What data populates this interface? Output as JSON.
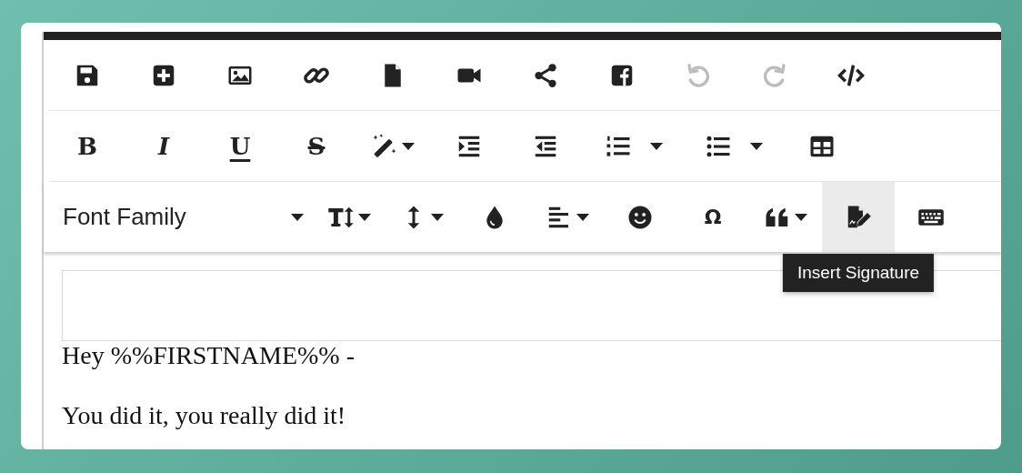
{
  "toolbar": {
    "rows": [
      [
        {
          "disabled": false
        },
        {
          "disabled": false
        },
        {
          "disabled": false
        },
        {
          "disabled": false
        },
        {
          "disabled": false
        },
        {
          "disabled": false
        },
        {
          "disabled": false
        },
        {
          "disabled": false
        },
        {
          "disabled": true
        },
        {
          "disabled": true
        },
        {
          "disabled": false
        }
      ],
      [
        {
          "label": "B",
          "dropdown": false
        },
        {
          "label": "I",
          "dropdown": false
        },
        {
          "label": "U",
          "dropdown": false
        },
        {
          "label": "S",
          "dropdown": false
        },
        {
          "dropdown": true
        },
        {
          "dropdown": false
        },
        {
          "dropdown": false
        },
        {
          "dropdown": true
        },
        {
          "dropdown": true
        },
        {
          "dropdown": false
        }
      ],
      [
        {
          "kind": "select",
          "value": "Font Family",
          "dropdown": true,
          "hovered": false
        },
        {
          "kind": "button",
          "dropdown": true,
          "hovered": false
        },
        {
          "kind": "button",
          "dropdown": true,
          "hovered": false
        },
        {
          "kind": "button",
          "dropdown": false,
          "hovered": false
        },
        {
          "kind": "button",
          "dropdown": true,
          "hovered": false
        },
        {
          "kind": "button",
          "dropdown": false,
          "hovered": false
        },
        {
          "kind": "button",
          "label": "Ω",
          "dropdown": false,
          "hovered": false
        },
        {
          "kind": "button",
          "dropdown": true,
          "hovered": false
        },
        {
          "kind": "button",
          "dropdown": false,
          "hovered": true
        },
        {
          "kind": "button",
          "dropdown": false,
          "hovered": false
        }
      ]
    ]
  },
  "tooltip": "Insert Signature",
  "body": [
    "Hey %%FIRSTNAME%% -",
    "You did it, you really did it!"
  ]
}
